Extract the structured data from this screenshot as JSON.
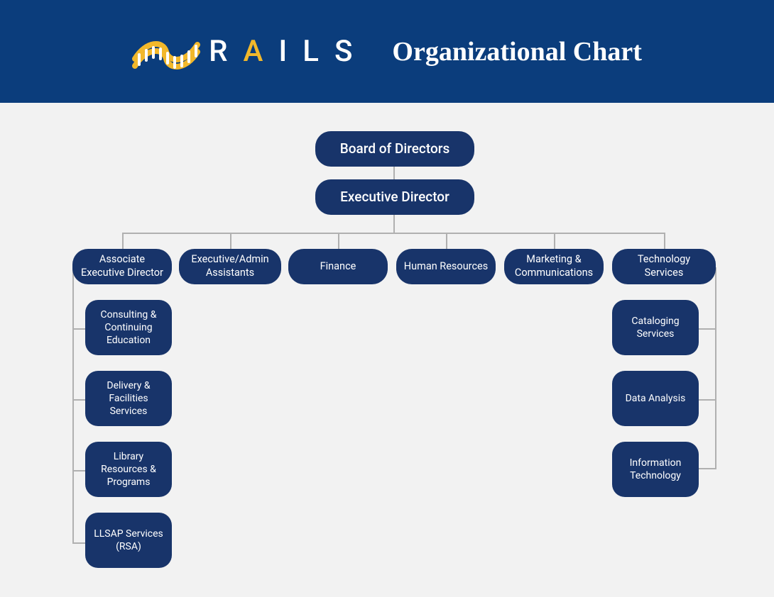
{
  "header": {
    "brand_text_pre": "R",
    "brand_text_accent": "A",
    "brand_text_post": "ILS",
    "title": "Organizational Chart"
  },
  "colors": {
    "brand_navy": "#183d7a",
    "brand_gold": "#f2b82b",
    "node_bg": "#18346a",
    "page_bg": "#f2f2f2",
    "line": "#b0b0b0"
  },
  "chart_data": {
    "type": "org_chart",
    "root": {
      "label": "Board of Directors",
      "children": [
        {
          "label": "Executive Director",
          "children": [
            {
              "label": "Associate Executive Director",
              "children": [
                {
                  "label": "Consulting & Continuing Education"
                },
                {
                  "label": "Delivery & Facilities Services"
                },
                {
                  "label": "Library Resources & Programs"
                },
                {
                  "label": "LLSAP Services (RSA)"
                }
              ]
            },
            {
              "label": "Executive/Admin Assistants"
            },
            {
              "label": "Finance"
            },
            {
              "label": "Human Resources"
            },
            {
              "label": "Marketing & Communications"
            },
            {
              "label": "Technology Services",
              "children": [
                {
                  "label": "Cataloging Services"
                },
                {
                  "label": "Data Analysis"
                },
                {
                  "label": "Information Technology"
                }
              ]
            }
          ]
        }
      ]
    }
  }
}
